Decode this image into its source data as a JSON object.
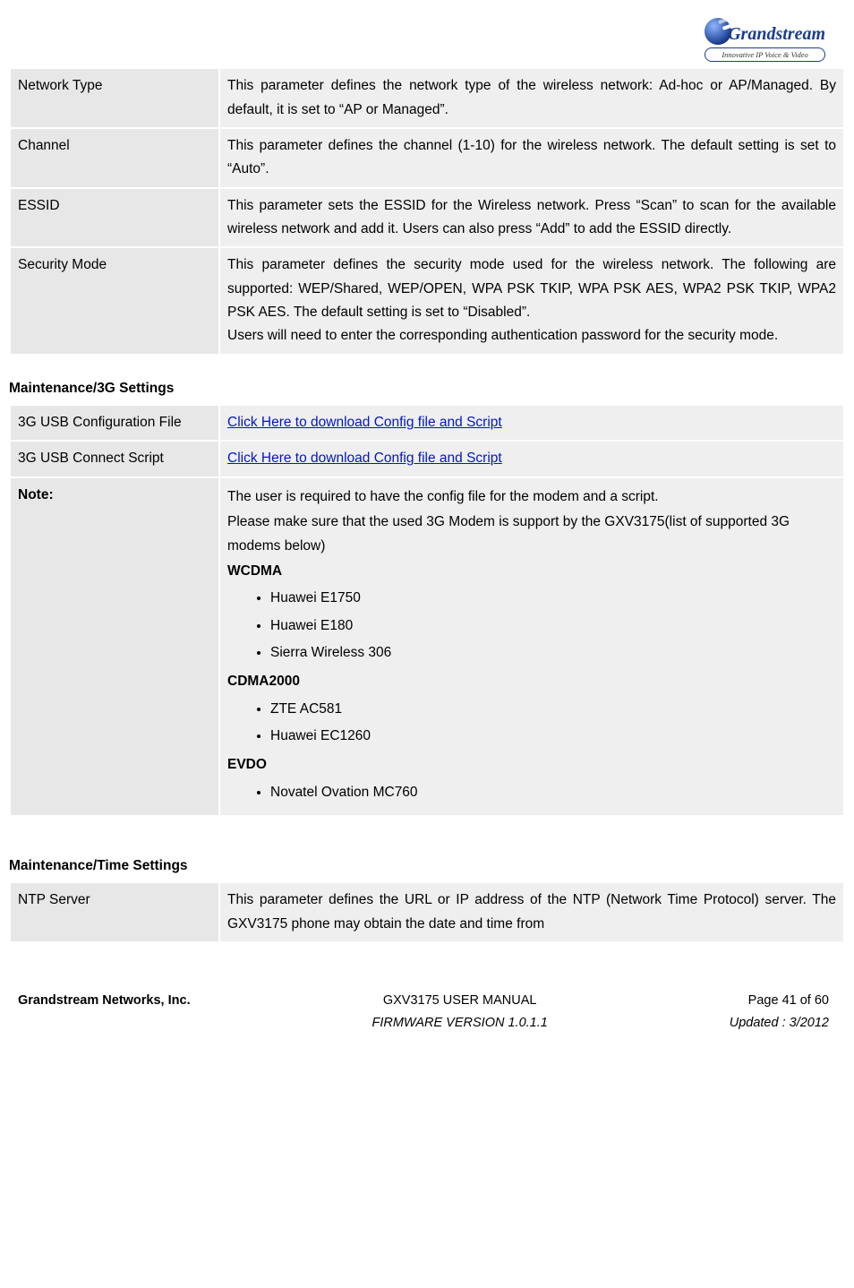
{
  "brand": {
    "name": "Grandstream",
    "tagline": "Innovative IP Voice & Video"
  },
  "tables": {
    "wifi": [
      {
        "label": "Network Type",
        "desc": "This parameter defines the network type of the wireless network: Ad-hoc or AP/Managed. By default, it is set to “AP or Managed”."
      },
      {
        "label": "Channel",
        "desc": "This parameter defines the channel (1-10) for the wireless network. The default setting is set to “Auto”."
      },
      {
        "label": "ESSID",
        "desc": "This parameter sets the ESSID for the Wireless network. Press “Scan” to scan for the available wireless network and add it. Users can also press “Add” to add the ESSID directly."
      },
      {
        "label": "Security Mode",
        "desc": "This parameter defines the security mode used for the wireless network. The following are supported: WEP/Shared, WEP/OPEN, WPA PSK TKIP, WPA PSK AES, WPA2 PSK TKIP, WPA2 PSK AES. The default setting is set to “Disabled”.\nUsers will need to enter the corresponding authentication password for the security mode."
      }
    ],
    "g3_title": "Maintenance/3G Settings",
    "g3": {
      "row1_label": "3G USB Configuration File",
      "row2_label": "3G USB Connect Script",
      "link_text": "Click Here to download Config file and Script",
      "note_label": "Note:",
      "note_p1": "The user is required to have the config file for the modem and a script.",
      "note_p2": "Please make sure that the used 3G Modem is support by the GXV3175(list of supported 3G modems below)",
      "wcdma_h": "WCDMA",
      "wcdma": [
        "Huawei E1750",
        "Huawei E180",
        "Sierra Wireless 306"
      ],
      "cdma_h": "CDMA2000",
      "cdma": [
        "ZTE AC581",
        "Huawei EC1260"
      ],
      "evdo_h": "EVDO",
      "evdo": [
        "Novatel Ovation MC760"
      ]
    },
    "time_title": "Maintenance/Time Settings",
    "time": {
      "label": "NTP Server",
      "desc": "This parameter defines the URL or IP address of the NTP (Network Time Protocol) server. The GXV3175 phone may obtain the date and time from"
    }
  },
  "footer": {
    "company": "Grandstream Networks, Inc.",
    "manual": "GXV3175 USER MANUAL",
    "firmware": "FIRMWARE VERSION 1.0.1.1",
    "page": "Page 41 of 60",
    "updated": "Updated : 3/2012"
  }
}
